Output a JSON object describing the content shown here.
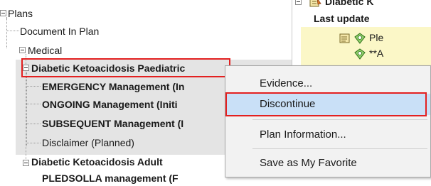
{
  "tree": {
    "root_label": "Plans",
    "document_label": "Document In Plan",
    "medical_label": "Medical",
    "dka_paediatric_label": "Diabetic Ketoacidosis Paediatric",
    "emergency_label": "EMERGENCY Management (In",
    "ongoing_label": "ONGOING Management (Initi",
    "subsequent_label": "SUBSEQUENT Management (I",
    "disclaimer_label": "Disclaimer (Planned)",
    "dka_adult_label": "Diabetic Ketoacidosis Adult",
    "cutoff_label": "PLEDSOLLA management (F"
  },
  "right_pane": {
    "header_label": "Diabetic K",
    "last_update_label": "Last update",
    "row1_label": "Ple",
    "row2_label": "**A"
  },
  "context_menu": {
    "items": [
      {
        "label": "Evidence..."
      },
      {
        "label": "Discontinue"
      },
      {
        "label": "Plan Information..."
      },
      {
        "label": "Save as My Favorite"
      }
    ],
    "highlighted_index": 1
  },
  "colors": {
    "highlight": "#c9e0f7",
    "callout_red": "#e32020",
    "yellow_panel": "#fbf7c7"
  },
  "icons": {
    "plan_icon": "plan-icon",
    "order_icon": "order-icon"
  }
}
